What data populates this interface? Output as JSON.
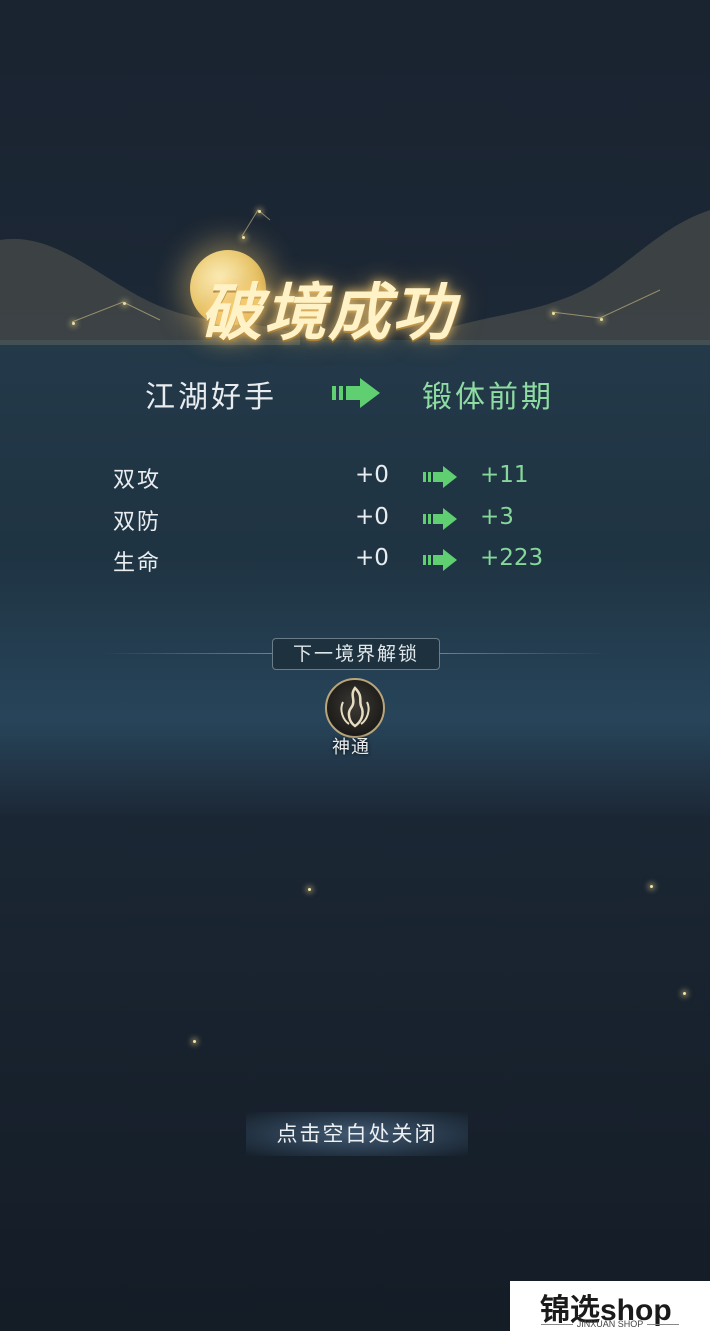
{
  "title": "破境成功",
  "rank": {
    "from": "江湖好手",
    "to": "锻体前期"
  },
  "stats": [
    {
      "label": "双攻",
      "from": "+0",
      "to": "+11"
    },
    {
      "label": "双防",
      "from": "+0",
      "to": "+3"
    },
    {
      "label": "生命",
      "from": "+0",
      "to": "+223"
    }
  ],
  "unlock": {
    "heading": "下一境界解锁",
    "skill": {
      "name": "神通",
      "icon": "flame-hand-icon"
    }
  },
  "close_hint": "点击空白处关闭",
  "watermark": {
    "main": "锦选shop",
    "sub": "JINXUAN SHOP"
  },
  "colors": {
    "gain": "#86d79a",
    "arrow": "#5fcf72",
    "title_glow": "#f0c870"
  }
}
